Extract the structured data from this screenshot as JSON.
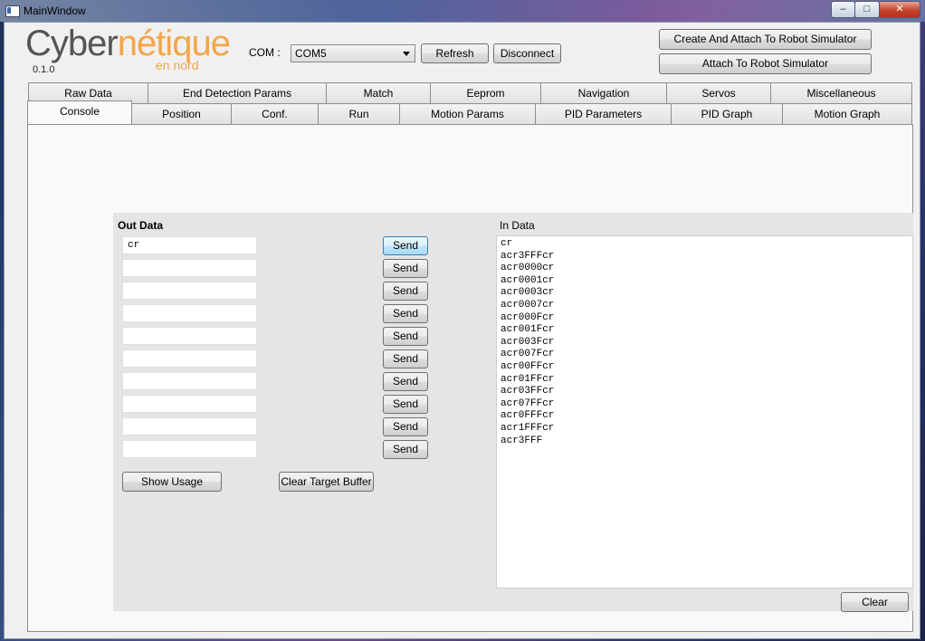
{
  "window": {
    "title": "MainWindow",
    "min_icon": "minimize-icon",
    "max_icon": "maximize-icon",
    "close_icon": "close-icon"
  },
  "logo": {
    "part1": "Cyber",
    "part2": "nétique",
    "sub": "en nord",
    "version": "0.1.0"
  },
  "com": {
    "label": "COM :",
    "selected": "COM5"
  },
  "toolbar": {
    "refresh": "Refresh",
    "disconnect": "Disconnect",
    "create_attach": "Create And Attach To Robot Simulator",
    "attach": "Attach To Robot Simulator"
  },
  "tabs_row1": [
    "Raw Data",
    "End Detection Params",
    "Match",
    "Eeprom",
    "Navigation",
    "Servos",
    "Miscellaneous"
  ],
  "tabs_row2": [
    "Console",
    "Position",
    "Conf.",
    "Run",
    "Motion Params",
    "PID Parameters",
    "PID Graph",
    "Motion Graph"
  ],
  "console": {
    "out_label": "Out Data",
    "in_label": "In Data",
    "out_fields": [
      "cr",
      "",
      "",
      "",
      "",
      "",
      "",
      "",
      "",
      ""
    ],
    "send_label": "Send",
    "show_usage": "Show Usage",
    "clear_target": "Clear Target Buffer",
    "clear": "Clear",
    "in_lines": [
      "cr",
      "acr3FFFcr",
      "acr0000cr",
      "acr0001cr",
      "acr0003cr",
      "acr0007cr",
      "acr000Fcr",
      "acr001Fcr",
      "acr003Fcr",
      "acr007Fcr",
      "acr00FFcr",
      "acr01FFcr",
      "acr03FFcr",
      "acr07FFcr",
      "acr0FFFcr",
      "acr1FFFcr",
      "acr3FFF"
    ]
  },
  "colors": {
    "accent": "#f2a64a",
    "logo_gray": "#555555",
    "focus_blue": "#3c7fb1"
  }
}
